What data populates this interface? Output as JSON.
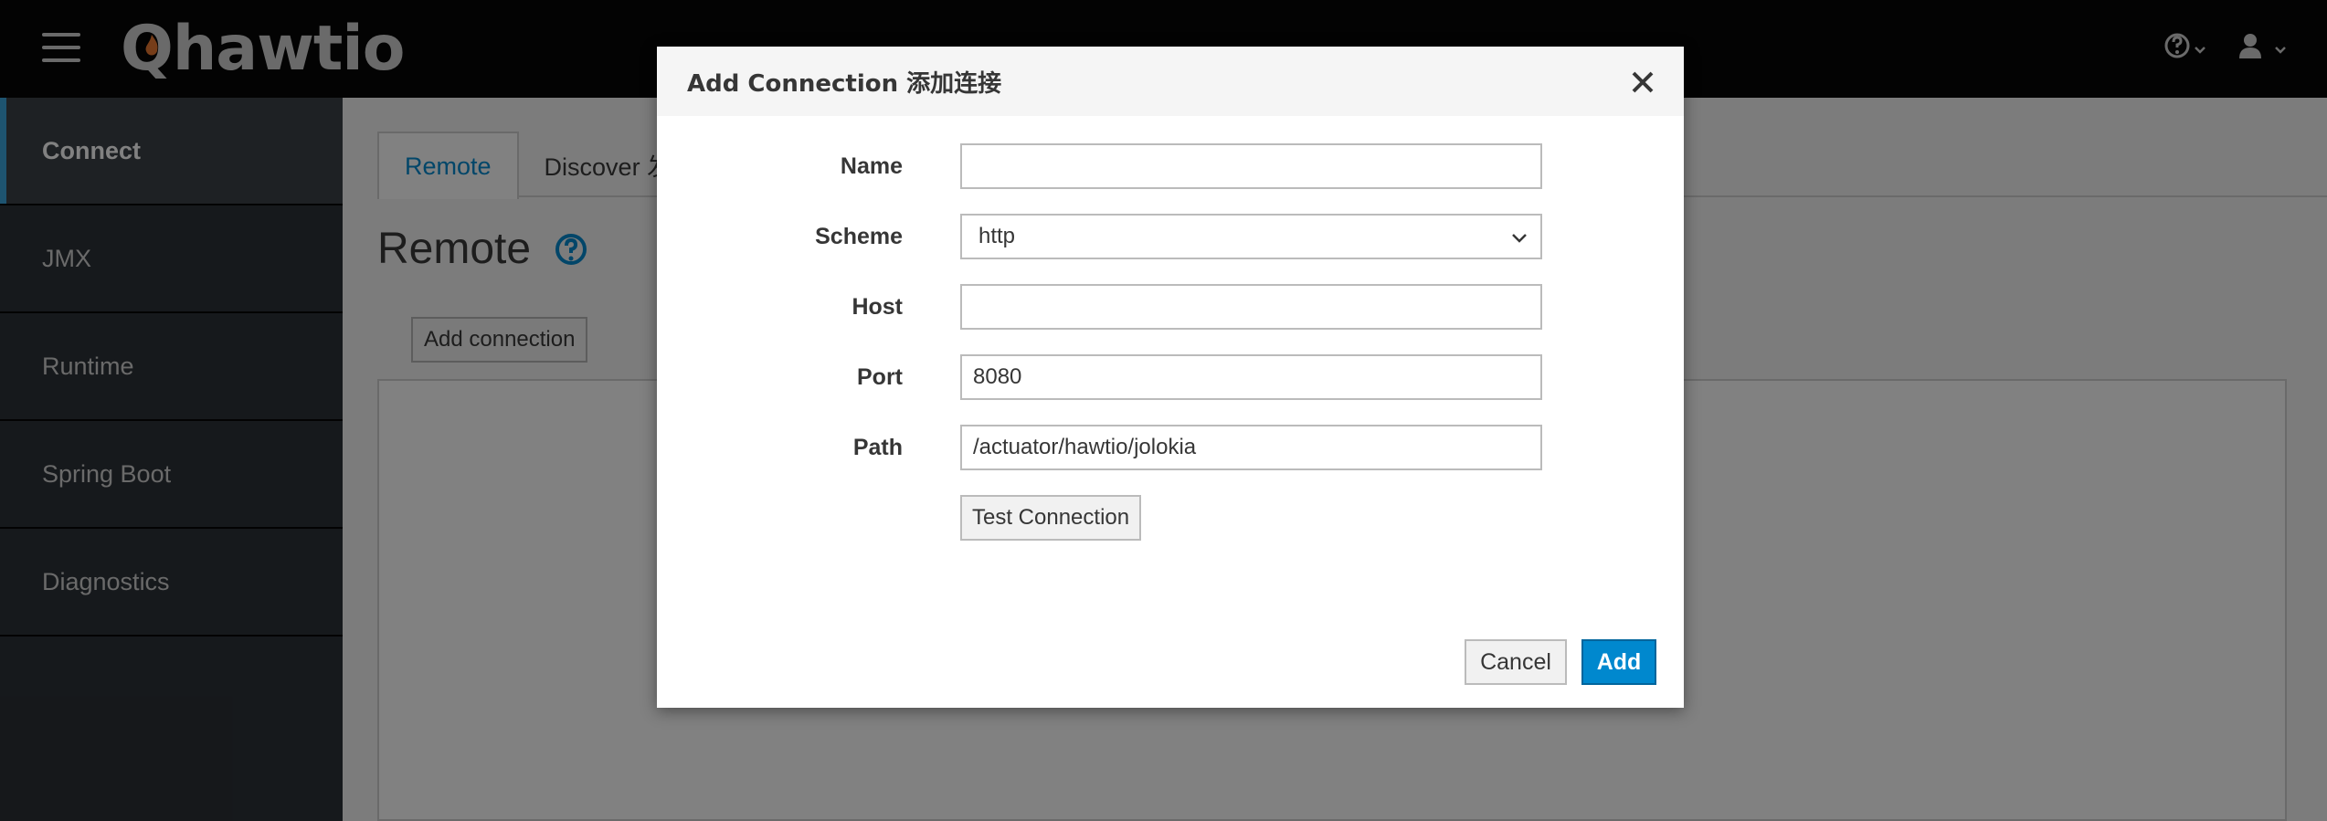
{
  "header": {
    "logo_text": "hawtio",
    "hamburger_icon": "hamburger-icon",
    "help_icon": "question-circle-icon",
    "user_icon": "user-icon"
  },
  "sidebar": {
    "items": [
      {
        "label": "Connect",
        "active": true
      },
      {
        "label": "JMX"
      },
      {
        "label": "Runtime"
      },
      {
        "label": "Spring Boot"
      },
      {
        "label": "Diagnostics"
      }
    ]
  },
  "main": {
    "tabs": [
      {
        "label": "Remote",
        "active": true
      },
      {
        "label": "Discover 发"
      }
    ],
    "page_title": "Remote",
    "add_connection_label": "Add connection"
  },
  "modal": {
    "title": "Add Connection 添加连接",
    "fields": {
      "name": {
        "label": "Name",
        "value": ""
      },
      "scheme": {
        "label": "Scheme",
        "value": "http"
      },
      "host": {
        "label": "Host",
        "value": ""
      },
      "port": {
        "label": "Port",
        "value": "8080"
      },
      "path": {
        "label": "Path",
        "value": "/actuator/hawtio/jolokia"
      }
    },
    "test_connection_label": "Test Connection",
    "cancel_label": "Cancel",
    "add_label": "Add"
  },
  "colors": {
    "accent": "#0088ce",
    "header_bg": "#030303",
    "sidebar_bg": "#292e34",
    "active_indicator": "#39a5dc"
  }
}
